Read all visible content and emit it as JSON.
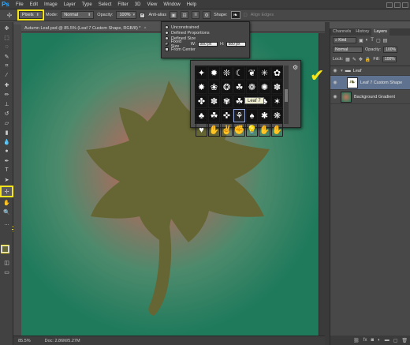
{
  "app": {
    "logo": "Ps"
  },
  "menu": [
    "File",
    "Edit",
    "Image",
    "Layer",
    "Type",
    "Select",
    "Filter",
    "3D",
    "View",
    "Window",
    "Help"
  ],
  "options_bar": {
    "tool_mode": "Pixels",
    "mode_label": "Mode:",
    "mode_value": "Normal",
    "opacity_label": "Opacity:",
    "opacity_value": "100%",
    "anti_alias_label": "Anti-alias",
    "shape_label": "Shape:",
    "align_edges_label": "Align Edges"
  },
  "document": {
    "tab_title": "Autumn Leaf.psd @ 85.5% (Leaf 7 Custom Shape, RGB/8) *",
    "zoom": "85.5%",
    "doc_info": "Doc: 2.86M/5.27M"
  },
  "shape_options": {
    "unconstrained": "Unconstrained",
    "defined_proportions": "Defined Proportions",
    "defined_size": "Defined Size",
    "fixed_size": "Fixed Size",
    "w_label": "W:",
    "w_value": "880 px",
    "h_label": "H:",
    "h_value": "880 px",
    "from_center": "From Center",
    "selected": "fixed_size"
  },
  "shape_picker": {
    "shapes": [
      "✦",
      "✹",
      "❊",
      "☾",
      "❦",
      "✳",
      "✿",
      "✸",
      "❀",
      "❂",
      "☘",
      "❁",
      "✺",
      "✽",
      "✤",
      "✽",
      "✾",
      "☘",
      "❧",
      "♣",
      "✶",
      "♣",
      "☘",
      "✜",
      "⚘",
      "♠",
      "✱",
      "❋",
      "♥",
      "✋",
      "✌",
      "✊",
      "💡",
      "✋",
      "✋"
    ],
    "selected_index": 24,
    "tooltip": "Leaf 7"
  },
  "foreground_color": {
    "hex_label": "#666634",
    "color": "#666634"
  },
  "accent_color": "#f7e51c",
  "layers_panel": {
    "tabs": [
      "Channels",
      "History",
      "Layers"
    ],
    "active_tab": "Layers",
    "filter_label": "Kind",
    "blend_mode": "Normal",
    "opacity_label": "Opacity:",
    "opacity_value": "100%",
    "lock_label": "Lock:",
    "fill_label": "Fill:",
    "fill_value": "100%",
    "layers": [
      {
        "name": "Leaf",
        "type": "group"
      },
      {
        "name": "Leaf 7 Custom Shape",
        "type": "shape",
        "selected": true
      },
      {
        "name": "Background Gradient",
        "type": "pixel"
      }
    ]
  },
  "leaf_color": "#666634"
}
